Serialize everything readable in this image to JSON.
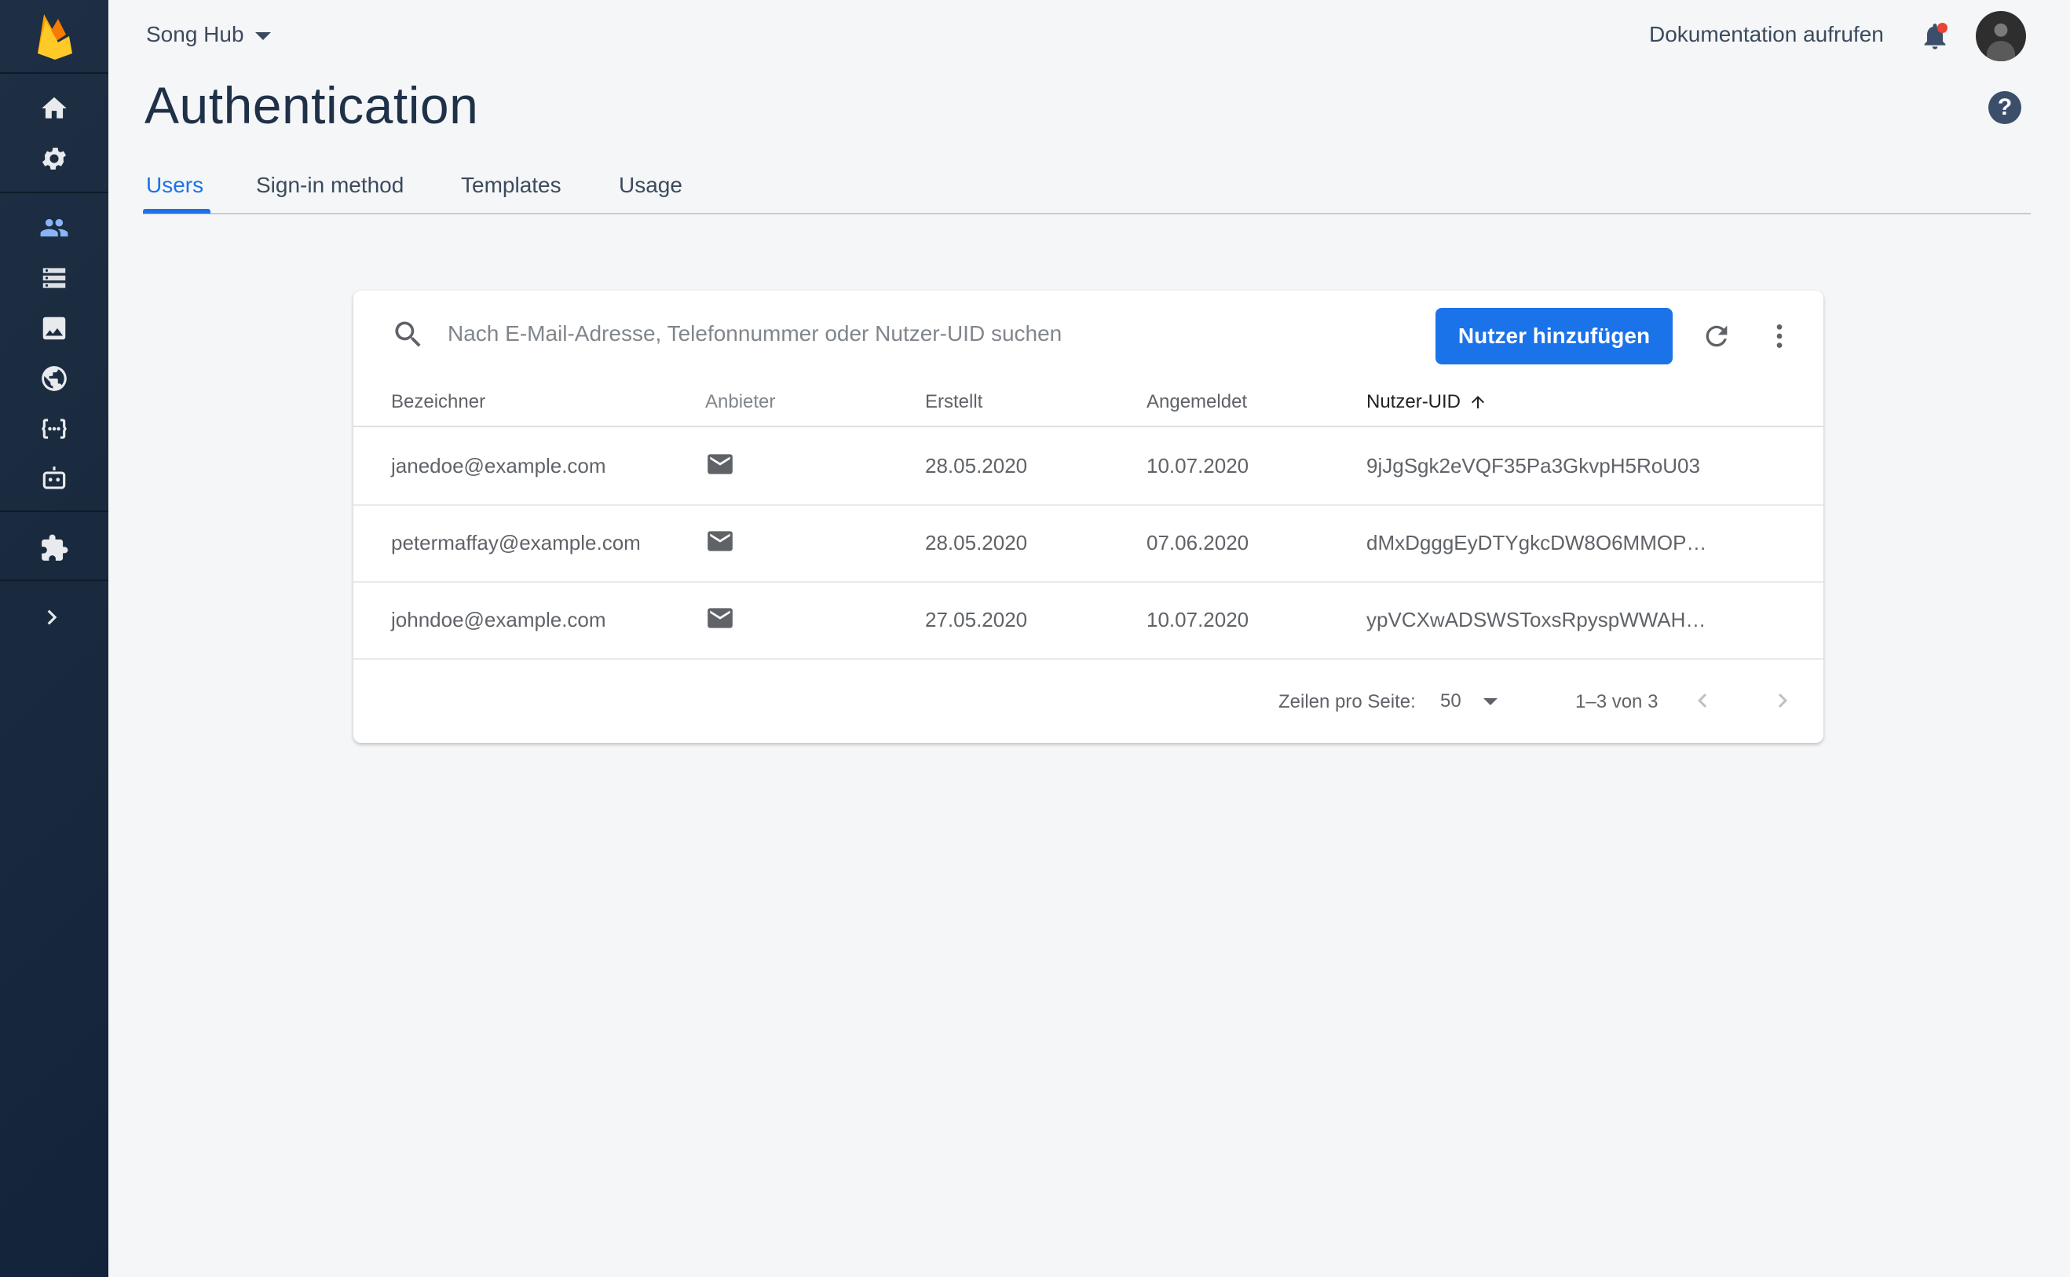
{
  "header": {
    "project_name": "Song Hub",
    "docs_link": "Dokumentation aufrufen",
    "page_title": "Authentication",
    "help_glyph": "?"
  },
  "tabs": [
    {
      "label": "Users",
      "active": true
    },
    {
      "label": "Sign-in method",
      "active": false
    },
    {
      "label": "Templates",
      "active": false
    },
    {
      "label": "Usage",
      "active": false
    }
  ],
  "sidebar": {
    "icons": [
      "firebase-logo",
      "home-icon",
      "settings-icon",
      "authentication-icon",
      "database-icon",
      "storage-icon",
      "hosting-icon",
      "functions-icon",
      "ml-kit-icon",
      "extensions-icon",
      "expand-icon"
    ],
    "active": "authentication-icon"
  },
  "users_table": {
    "search_placeholder": "Nach E-Mail-Adresse, Telefonnummer oder Nutzer-UID suchen",
    "add_button": "Nutzer hinzufügen",
    "columns": [
      "Bezeichner",
      "Anbieter",
      "Erstellt",
      "Angemeldet",
      "Nutzer-UID"
    ],
    "sorted_column": "Nutzer-UID",
    "sort_direction": "ascending",
    "rows": [
      {
        "identifier": "janedoe@example.com",
        "provider": "mail-icon",
        "created": "28.05.2020",
        "signed_in": "10.07.2020",
        "uid": "9jJgSgk2eVQF35Pa3GkvpH5RoU03"
      },
      {
        "identifier": "petermaffay@example.com",
        "provider": "mail-icon",
        "created": "28.05.2020",
        "signed_in": "07.06.2020",
        "uid": "dMxDgggEyDTYgkcDW8O6MMOP…"
      },
      {
        "identifier": "johndoe@example.com",
        "provider": "mail-icon",
        "created": "27.05.2020",
        "signed_in": "10.07.2020",
        "uid": "ypVCXwADSWSToxsRpyspWWAH…"
      }
    ],
    "pagination": {
      "rows_per_page_label": "Zeilen pro Seite:",
      "rows_per_page": "50",
      "range": "1–3 von 3"
    }
  },
  "colors": {
    "accent": "#1a73e8",
    "sidebar": "#1b2a3f",
    "title": "#1f3148",
    "notification_dot": "#ea4335"
  }
}
